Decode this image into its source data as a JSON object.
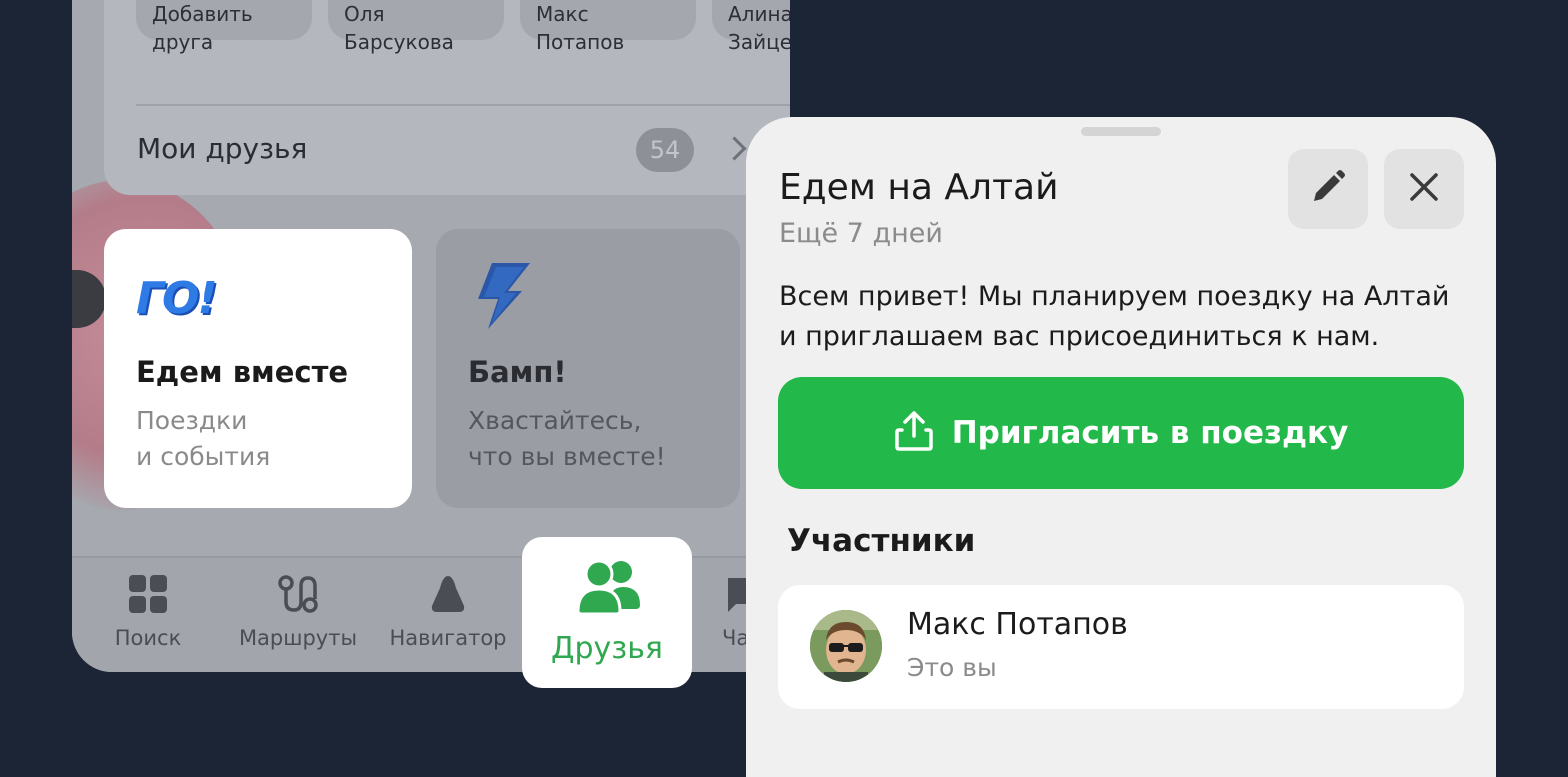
{
  "friends_row": [
    {
      "line1": "Добавить",
      "line2": "друга"
    },
    {
      "line1": "Оля",
      "line2": "Барсукова"
    },
    {
      "line1": "Макс",
      "line2": "Потапов"
    },
    {
      "line1": "Алина",
      "line2": "Зайце"
    }
  ],
  "my_friends": {
    "label": "Мои друзья",
    "count": "54"
  },
  "promos": [
    {
      "logo": "ГО!",
      "title": "Едем вместе",
      "sub1": "Поездки",
      "sub2": "и события"
    },
    {
      "icon": "lightning-icon",
      "title": "Бамп!",
      "sub1": "Хвастайтесь,",
      "sub2": "что вы вместе!"
    }
  ],
  "tabbar": {
    "items": [
      {
        "label": "Поиск",
        "icon": "grid-icon"
      },
      {
        "label": "Маршруты",
        "icon": "route-icon"
      },
      {
        "label": "Навигатор",
        "icon": "navigator-icon"
      },
      {
        "label": "Друзья",
        "icon": "friends-icon",
        "active": true
      },
      {
        "label": "Ча",
        "icon": "chat-icon"
      }
    ]
  },
  "sheet": {
    "title": "Едем на Алтай",
    "subtitle": "Ещё 7 дней",
    "description_line1": "Всем привет! Мы планируем поездку на Алтай",
    "description_line2": "и приглашаем вас присоединиться к нам.",
    "invite_button": "Пригласить в поездку",
    "participants_heading": "Участники",
    "participants": [
      {
        "name": "Макс Потапов",
        "note": "Это вы"
      }
    ]
  },
  "colors": {
    "accent_green": "#22b84a",
    "friends_tab_green": "#2fa84f",
    "background": "#1b2535"
  }
}
